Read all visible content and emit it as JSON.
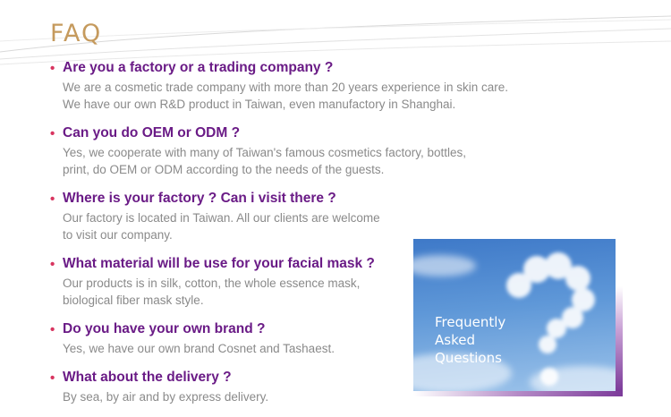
{
  "page": {
    "title": "FAQ"
  },
  "faq": [
    {
      "question": "Are you a factory or a trading company ?",
      "answer_lines": [
        "We are a cosmetic trade company with more than 20 years experience in skin care.",
        "We have our own R&D product in Taiwan, even manufactory in Shanghai."
      ]
    },
    {
      "question": "Can you do OEM or ODM ?",
      "answer_lines": [
        "Yes, we cooperate with many of Taiwan's famous cosmetics factory, bottles,",
        "print, do OEM or ODM according to the needs of the guests."
      ]
    },
    {
      "question": "Where is your factory ?  Can i visit there ?",
      "answer_lines": [
        "Our factory is located in Taiwan. All our clients are welcome",
        "to visit our company."
      ]
    },
    {
      "question": "What material will be use for your facial mask ?",
      "answer_lines": [
        "Our products is in silk, cotton, the whole essence mask,",
        "biological fiber mask style."
      ]
    },
    {
      "question": "Do you have your own brand ?",
      "answer_lines": [
        "Yes, we have our own brand Cosnet and Tashaest."
      ]
    },
    {
      "question": "What about the delivery ?",
      "answer_lines": [
        "By sea, by air and by express delivery."
      ]
    }
  ],
  "image_card": {
    "lines": [
      "Frequently",
      "Asked",
      "Questions"
    ]
  },
  "colors": {
    "title": "#c59a5d",
    "question": "#6a1b86",
    "answer": "#8a8a8a",
    "bullet": "#d8345f"
  }
}
